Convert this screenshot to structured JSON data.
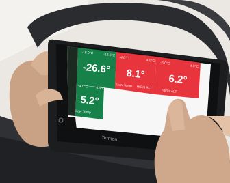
{
  "photo": {
    "subject": "Hands holding a rugged in-vehicle tablet in front of a steering wheel",
    "brand_mark": "Termon"
  },
  "display": {
    "tiles": [
      {
        "id": "zone1",
        "value": "-26.6°",
        "status": "green",
        "top_left": "-18.0°C",
        "top_right": "-18.0°C"
      },
      {
        "id": "zone2",
        "value": "8.1°",
        "status": "red",
        "top_left": "-4.0°C",
        "top_right": "4.0°C",
        "footer": "Low Temp",
        "footer_right": "HIGH ALT"
      },
      {
        "id": "zone3",
        "value": "6.2°",
        "status": "red",
        "top_left": "-6.0°C",
        "top_right": "4.0°C",
        "footer": "HIGH ALT"
      },
      {
        "id": "zone4",
        "value": "5.2°",
        "status": "green",
        "top_left": "-4.0°C",
        "top_right": "4.0°C",
        "footer": "Low Temp"
      }
    ],
    "colors": {
      "ok": "#17814a",
      "alert": "#e8343d",
      "bezel": "#1d1f21"
    }
  }
}
